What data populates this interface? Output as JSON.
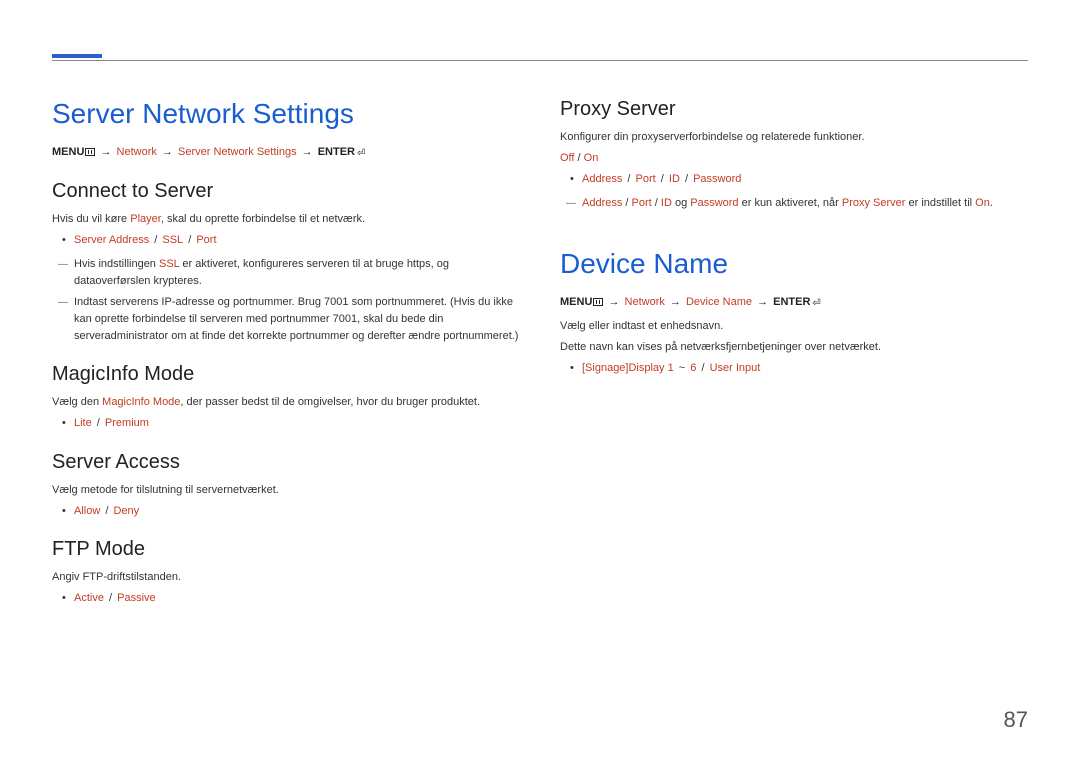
{
  "page_number": "87",
  "left": {
    "h1": "Server Network Settings",
    "breadcrumb": {
      "menu": "MENU",
      "path1": "Network",
      "path2": "Server Network Settings",
      "enter": "ENTER"
    },
    "connect": {
      "title": "Connect to Server",
      "intro_pre": "Hvis du vil køre ",
      "intro_red": "Player",
      "intro_post": ", skal du oprette forbindelse til et netværk.",
      "opts": {
        "a": "Server Address",
        "b": "SSL",
        "c": "Port"
      },
      "note1_pre": "Hvis indstillingen ",
      "note1_red": "SSL",
      "note1_post": " er aktiveret, konfigureres serveren til at bruge https, og dataoverførslen krypteres.",
      "note2": "Indtast serverens IP-adresse og portnummer. Brug 7001 som portnummeret. (Hvis du ikke kan oprette forbindelse til serveren med portnummer 7001, skal du bede din serveradministrator om at finde det korrekte portnummer og derefter ændre portnummeret.)"
    },
    "magic": {
      "title": "MagicInfo Mode",
      "intro_pre": "Vælg den ",
      "intro_red": "MagicInfo Mode",
      "intro_post": ", der passer bedst til de omgivelser, hvor du bruger produktet.",
      "opts": {
        "a": "Lite",
        "b": "Premium"
      }
    },
    "access": {
      "title": "Server Access",
      "intro": "Vælg metode for tilslutning til servernetværket.",
      "opts": {
        "a": "Allow",
        "b": "Deny"
      }
    },
    "ftp": {
      "title": "FTP Mode",
      "intro": "Angiv FTP-driftstilstanden.",
      "opts": {
        "a": "Active",
        "b": "Passive"
      }
    }
  },
  "right": {
    "proxy": {
      "title": "Proxy Server",
      "intro": "Konfigurer din proxyserverforbindelse og relaterede funktioner.",
      "toggle": {
        "a": "Off",
        "b": "On"
      },
      "opts": {
        "a": "Address",
        "b": "Port",
        "c": "ID",
        "d": "Password"
      },
      "note": {
        "p1": "Address",
        "s1": " / ",
        "p2": "Port",
        "s2": " / ",
        "p3": "ID",
        "s3": " og ",
        "p4": "Password",
        "s4": " er kun aktiveret, når ",
        "p5": "Proxy Server",
        "s5": " er indstillet til ",
        "p6": "On",
        "s6": "."
      }
    },
    "device": {
      "h1": "Device Name",
      "breadcrumb": {
        "menu": "MENU",
        "path1": "Network",
        "path2": "Device Name",
        "enter": "ENTER"
      },
      "line1": "Vælg eller indtast et enhedsnavn.",
      "line2": "Dette navn kan vises på netværksfjernbetjeninger over netværket.",
      "opts": {
        "a": "[Signage]Display 1",
        "tilde": " ~ ",
        "b": "6",
        "c": "User Input"
      }
    }
  }
}
